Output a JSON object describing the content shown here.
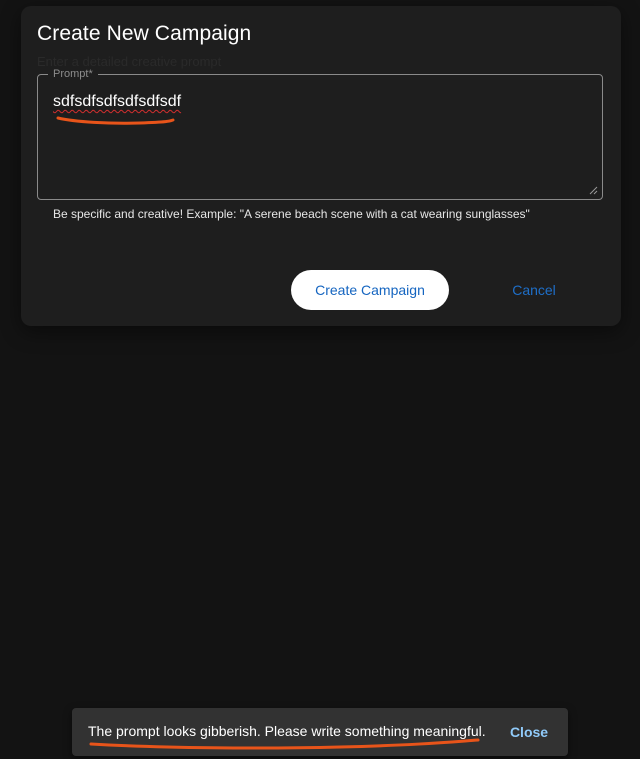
{
  "dialog": {
    "title": "Create New Campaign",
    "ghost_text": "Enter a detailed creative prompt",
    "prompt_field": {
      "label": "Prompt*",
      "value": "sdfsdfsdfsdfsdfsdf"
    },
    "helper_text": "Be specific and creative! Example: \"A serene beach scene with a cat wearing sunglasses\"",
    "create_button_label": "Create Campaign",
    "cancel_button_label": "Cancel"
  },
  "snackbar": {
    "message": "The prompt looks gibberish. Please write something meaningful.",
    "action_label": "Close"
  },
  "colors": {
    "background": "#131313",
    "dialog_surface": "#1e1e1e",
    "primary_text_button": "#1565c0",
    "snackbar_background": "#323232",
    "snackbar_action": "#90caf9",
    "annotation_stroke": "#e8541a",
    "spellcheck_underline": "#d32f2f"
  },
  "icons": {
    "resize_handle": "resize-grip-icon"
  }
}
